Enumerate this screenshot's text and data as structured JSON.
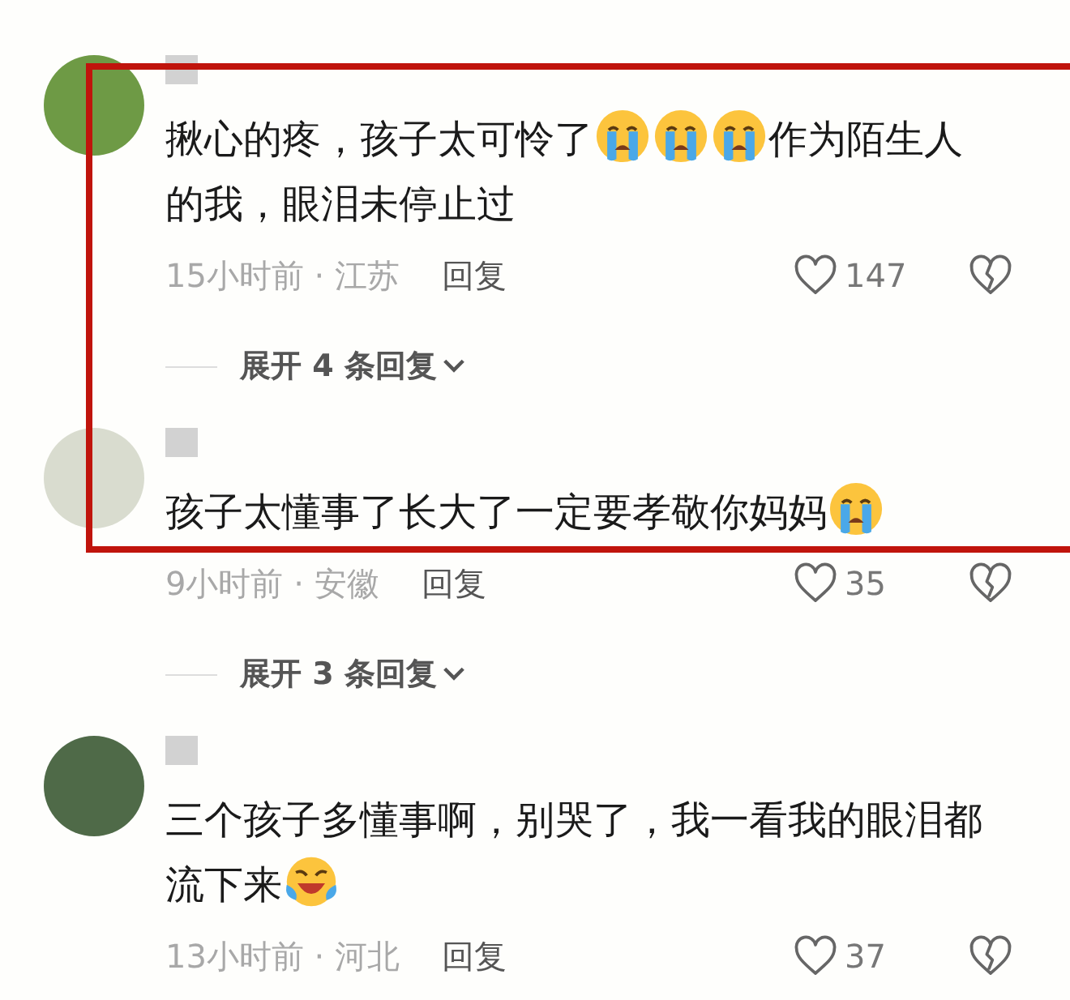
{
  "comments": [
    {
      "parts": [
        {
          "kind": "text",
          "text": "揪心的疼，孩子太可怜了"
        },
        {
          "kind": "crying-emoji"
        },
        {
          "kind": "crying-emoji"
        },
        {
          "kind": "crying-emoji"
        },
        {
          "kind": "text",
          "text": "作为陌生人的我，眼泪未停止过"
        }
      ],
      "time": "15小时前 · 江苏",
      "reply": "回复",
      "likes": "147",
      "expand": "展开 4 条回复"
    },
    {
      "parts": [
        {
          "kind": "text",
          "text": "孩子太懂事了长大了一定要孝敬你妈妈"
        },
        {
          "kind": "crying-emoji"
        }
      ],
      "time": "9小时前 · 安徽",
      "reply": "回复",
      "likes": "35",
      "expand": "展开 3 条回复"
    },
    {
      "parts": [
        {
          "kind": "text",
          "text": "三个孩子多懂事啊，别哭了，我一看我的眼泪都流下来"
        },
        {
          "kind": "laughing-crying-emoji"
        }
      ],
      "time": "13小时前 · 河北",
      "reply": "回复",
      "likes": "37"
    }
  ]
}
